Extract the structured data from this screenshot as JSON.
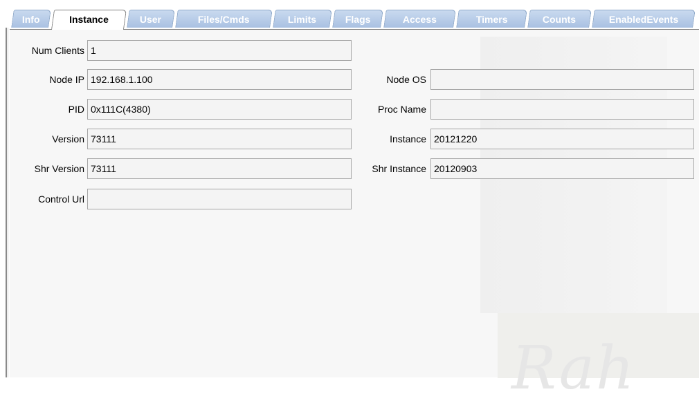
{
  "tabs": [
    {
      "label": "Info",
      "active": false
    },
    {
      "label": "Instance",
      "active": true
    },
    {
      "label": "User",
      "active": false
    },
    {
      "label": "Files/Cmds",
      "active": false
    },
    {
      "label": "Limits",
      "active": false
    },
    {
      "label": "Flags",
      "active": false
    },
    {
      "label": "Access",
      "active": false
    },
    {
      "label": "Timers",
      "active": false
    },
    {
      "label": "Counts",
      "active": false
    },
    {
      "label": "EnabledEvents",
      "active": false
    }
  ],
  "fields": {
    "num_clients": {
      "label": "Num Clients",
      "value": "1"
    },
    "node_ip": {
      "label": "Node IP",
      "value": "192.168.1.100"
    },
    "pid": {
      "label": "PID",
      "value": "0x111C(4380)"
    },
    "version": {
      "label": "Version",
      "value": "73111"
    },
    "shr_version": {
      "label": "Shr Version",
      "value": "73111"
    },
    "control_url": {
      "label": "Control Url",
      "value": ""
    },
    "node_os": {
      "label": "Node OS",
      "value": ""
    },
    "proc_name": {
      "label": "Proc Name",
      "value": ""
    },
    "instance": {
      "label": "Instance",
      "value": "20121220"
    },
    "shr_instance": {
      "label": "Shr Instance",
      "value": "20120903"
    }
  },
  "watermark": {
    "text": "Rah"
  },
  "colors": {
    "tab_inactive": "#b4c9e6",
    "tab_active": "#ffffff",
    "panel": "#f7f7f7",
    "field_border": "#a6a6a6"
  }
}
